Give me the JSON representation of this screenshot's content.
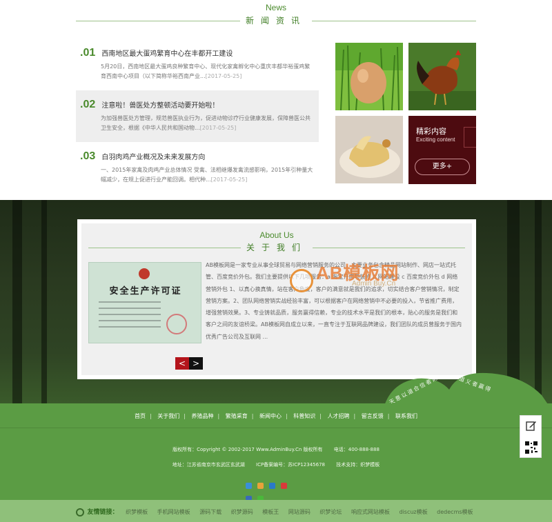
{
  "news": {
    "title_en": "News",
    "title_cn": "新闻资讯",
    "items": [
      {
        "num": ".01",
        "title": "西南地区最大蛋鸡繁育中心在丰都开工建设",
        "desc": "5月20日，西南地区最大蛋鸡良种繁育中心、现代化家禽孵化中心重庆丰都华裕蛋鸡繁育西南中心项目（以下简称华裕西南产业...",
        "date": "[2017-05-25]"
      },
      {
        "num": ".02",
        "title": "注意啦！兽医处方整顿活动要开始啦！",
        "desc": "为加强兽医处方管理，规范兽医执业行为，促进动物诊疗行业健康发展，保障兽医公共卫生安全，根据《中华人民共和国动物...",
        "date": "[2017-05-25]"
      },
      {
        "num": ".03",
        "title": "白羽肉鸡产业概况及未来发展方向",
        "desc": "一、2015年家禽及肉鸡产业总体情况 受禽、法相继爆发禽流感影响，2015年引种量大幅减少，在规上促进行业产能回调。相代种...",
        "date": "[2017-05-25]"
      }
    ],
    "promo": {
      "cn": "精彩内容",
      "en": "Exciting content",
      "more": "更多+"
    }
  },
  "about": {
    "title_en": "About Us",
    "title_cn": "关于我们",
    "cert_title": "安全生产许可证",
    "text": "AB模板网是一家专业从事全球贸易与网络营销服务的公司，主要业务包含精品网站制作、网店一站式托管、百度竞价外包。我们主要提供以下几项服务：a 淘宝开店与装修 b 网站建设 c 百度竞价外包 d 网络营销外包 1、以真心换真情，站在客户角度，客户的满意就是我们的追求，切实结合客户营销情况，制定营销方案。2、团队网络营销实战经验丰富，可以根据客户在网络营销中不必要的投入，节省推广费用，增强营销效果。3、专业铸就品质，服务赢得信赖，专业的技术水平是我们的根本，贴心的服务是我们和客户之间的友谊桥梁。AB模板网自成立以来，一直专注于互联网品牌建设，我们团队的成员曾服务于国内优秀广告公司及互联网 ...",
    "watermark": "AB模板网",
    "watermark_url": "Admin Buy.Cn",
    "prev": "<",
    "next": ">",
    "hill_text_1": "天意以道合信者财",
    "hill_text_2": "道义者赢得"
  },
  "footer": {
    "nav": [
      "首页",
      "关于我们",
      "养殖品种",
      "繁殖采育",
      "新闻中心",
      "科普知识",
      "人才招聘",
      "留言反馈",
      "联系我们"
    ],
    "copyright": "版权所有：Copyright © 2002-2017 Www.AdminBuy.Cn 版权所有",
    "phone": "电话：400-888-888",
    "address": "地址：江苏省南京市玄武区玄武湖",
    "icp": "ICP备案编号：苏ICP12345678",
    "support": "技术支持：织梦模板"
  },
  "links": {
    "label": "友情链接：",
    "items": [
      "织梦模板",
      "手机网站模板",
      "源码下载",
      "织梦源码",
      "模板王",
      "网站源码",
      "织梦论坛",
      "响应式网站模板",
      "discuz模板",
      "dedecms模板"
    ]
  },
  "colors": {
    "green": "#5b9c44",
    "accent_red": "#b4141b",
    "promo_bg": "#4d0b10"
  }
}
